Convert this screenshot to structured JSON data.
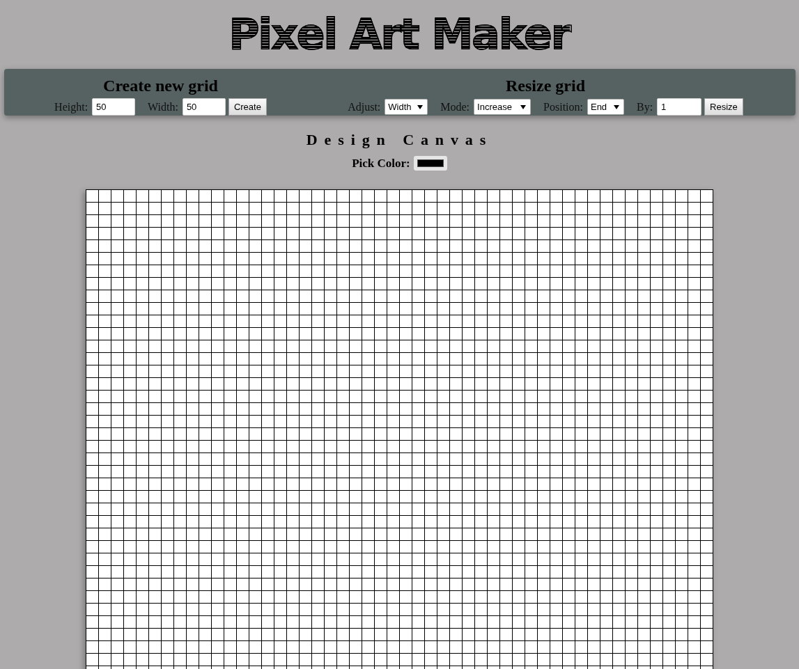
{
  "title": "Pixel Art Maker",
  "create": {
    "heading": "Create new grid",
    "height": {
      "label": "Height:",
      "value": "50"
    },
    "width": {
      "label": "Width:",
      "value": "50"
    },
    "button": "Create"
  },
  "resize": {
    "heading": "Resize grid",
    "controls": [
      {
        "kind": "select",
        "label": "Adjust:",
        "value": "Width"
      },
      {
        "kind": "select",
        "label": "Mode:",
        "value": "Increase"
      },
      {
        "kind": "select",
        "label": "Position:",
        "value": "End"
      },
      {
        "kind": "input",
        "label": "By:",
        "value": "1"
      }
    ],
    "button": "Resize"
  },
  "canvas": {
    "heading": "Design Canvas",
    "pick_color": {
      "label": "Pick Color:",
      "color": "#000000"
    }
  }
}
